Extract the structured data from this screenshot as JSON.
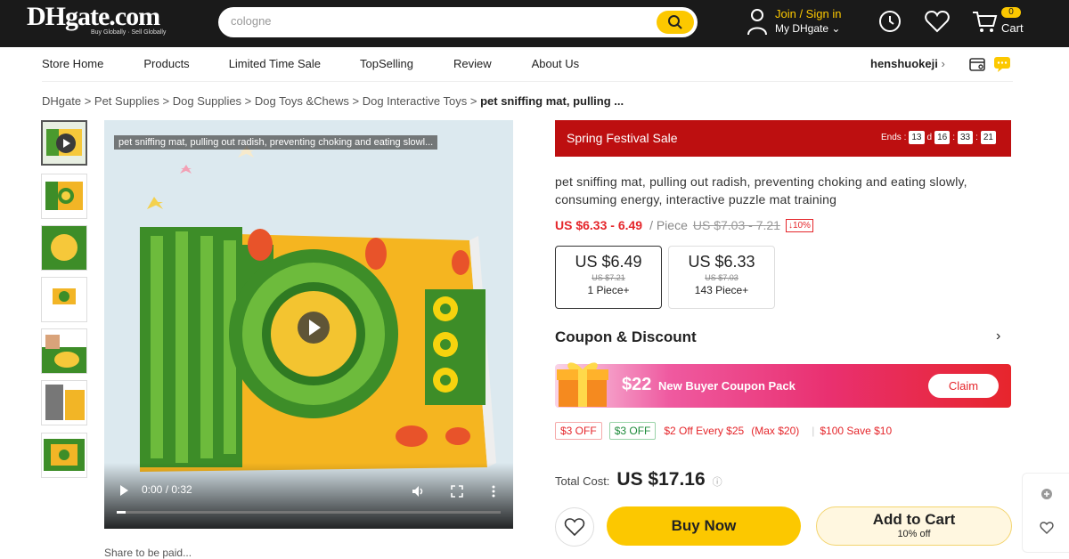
{
  "header": {
    "logo_text": "DHgate.com",
    "logo_tagline": "Buy Globally · Sell Globally",
    "search_value": "cologne",
    "join_label": "Join / Sign in",
    "my_label": "My DHgate",
    "cart_count": "0",
    "cart_label": "Cart"
  },
  "store": {
    "nav": [
      "Store Home",
      "Products",
      "Limited Time Sale",
      "TopSelling",
      "Review",
      "About Us"
    ],
    "name": "henshuokeji"
  },
  "breadcrumb": [
    "DHgate",
    "Pet Supplies",
    "Dog Supplies",
    "Dog Toys &Chews",
    "Dog Interactive Toys",
    "pet sniffing mat, pulling ..."
  ],
  "media": {
    "caption": "pet sniffing mat, pulling out radish, preventing choking and eating slowl...",
    "time": "0:00 / 0:32",
    "share_text": "Share to be paid..."
  },
  "sale": {
    "title": "Spring Festival Sale",
    "ends_label": "Ends :",
    "days": "13",
    "d": "d",
    "hours": "16",
    "minutes": "33",
    "seconds": "21",
    "sep": ":"
  },
  "product": {
    "title": "pet sniffing mat, pulling out radish, preventing choking and eating slowly, consuming energy, interactive puzzle mat training",
    "price_range": "US $6.33 - 6.49",
    "unit": "/ Piece",
    "orig_range": "US $7.03 - 7.21",
    "discount": "↓10%",
    "tiers": [
      {
        "price": "US $6.49",
        "orig": "US $7.21",
        "qty": "1 Piece+"
      },
      {
        "price": "US $6.33",
        "orig": "US $7.03",
        "qty": "143 Piece+"
      }
    ]
  },
  "coupon": {
    "heading": "Coupon & Discount",
    "amount": "$22",
    "label": "New Buyer Coupon Pack",
    "claim": "Claim",
    "tags": [
      "$3 OFF",
      "$3 OFF"
    ],
    "deal1": "$2 Off Every $25",
    "deal1_max": "(Max $20)",
    "deal2": "$100 Save $10"
  },
  "purchase": {
    "total_label": "Total Cost:",
    "total_value": "US $17.16",
    "buy_now": "Buy Now",
    "add_to_cart": "Add to Cart",
    "add_to_cart_sub": "10% off"
  },
  "colors": {
    "brand_yellow": "#fcc800",
    "sale_red": "#bd0f10",
    "price_red": "#e5262b"
  }
}
